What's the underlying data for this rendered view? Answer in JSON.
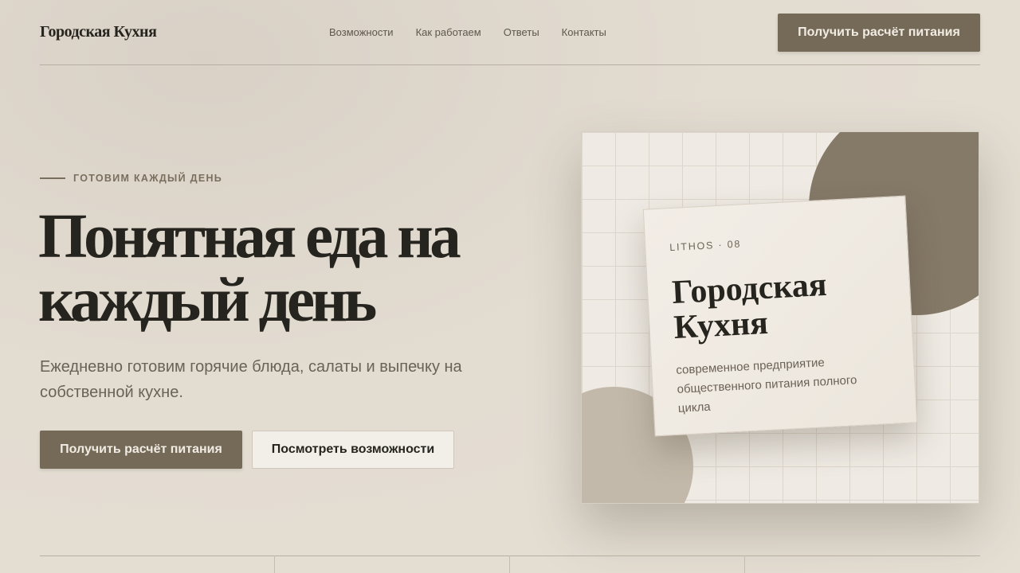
{
  "header": {
    "brand": "Городская Кухня",
    "nav": [
      "Возможности",
      "Как работаем",
      "Ответы",
      "Контакты"
    ],
    "cta": "Получить расчёт питания"
  },
  "hero": {
    "eyebrow": "ГОТОВИМ КАЖДЫЙ ДЕНЬ",
    "headline": "Понятная еда на каждый день",
    "lead": "Ежедневно готовим горячие блюда, салаты и выпечку на собственной кухне.",
    "primary_button": "Получить расчёт питания",
    "secondary_button": "Посмотреть возможности"
  },
  "card": {
    "tag": "LITHOS · 08",
    "title": "Городская Кухня",
    "description": "современное предприятие общественного питания полного цикла"
  },
  "colors": {
    "accent": "#756a58",
    "background": "#e3dcd1",
    "text": "#26241e",
    "muted": "#6a6257"
  }
}
